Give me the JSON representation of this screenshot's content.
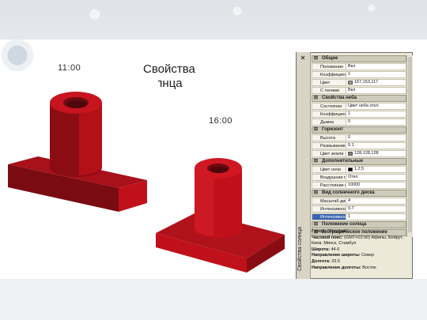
{
  "slide": {
    "time_left": "11:00",
    "time_right": "16:00",
    "title": "Свойства солнца"
  },
  "palette": {
    "solid_red": "#c0111a",
    "panel_bg": "#ece9d8",
    "selected": "#3a64b3"
  },
  "panel": {
    "side_label": "Свойства солнца",
    "sections": [
      {
        "title": "Общие",
        "rows": [
          {
            "key": "Положение",
            "value": "Вкл"
          },
          {
            "key": "Коэффициент ...",
            "value": "1"
          },
          {
            "key": "Цвет",
            "value": "167,153,117",
            "swatch": "#a79975"
          },
          {
            "key": "С тенями",
            "value": "Вкл"
          }
        ]
      },
      {
        "title": "Свойства неба",
        "rows": [
          {
            "key": "Состояние",
            "value": "Цвет неба откл"
          },
          {
            "key": "Коэффициент ...",
            "value": "1"
          },
          {
            "key": "Дымка",
            "value": "0"
          }
        ]
      },
      {
        "title": "Горизонт",
        "rows": [
          {
            "key": "Высота",
            "value": "0"
          },
          {
            "key": "Размывание",
            "value": "0.1"
          },
          {
            "key": "Цвет земли",
            "value": "128,128,128",
            "swatch": "#808080"
          }
        ]
      },
      {
        "title": "Дополнительные",
        "rows": [
          {
            "key": "Цвет ночи",
            "value": "1,2,5",
            "swatch": "#010205"
          },
          {
            "key": "Воздушная пе...",
            "value": "Откл"
          },
          {
            "key": "Расстояние ви...",
            "value": "10000"
          }
        ]
      },
      {
        "title": "Вид солнечного диска",
        "rows": [
          {
            "key": "Масштаб диска",
            "value": "4"
          },
          {
            "key": "Интенсивност...",
            "value": "0.7"
          },
          {
            "key": "Интенсивност...",
            "value": "1",
            "selected": true
          }
        ]
      },
      {
        "title": "Положение солнца",
        "rows": []
      },
      {
        "title": "Географическое положение",
        "rows": []
      }
    ],
    "geo": [
      {
        "label": "Город:",
        "value": "\"Текущий\""
      },
      {
        "label": "Часовой пояс:",
        "value": "(GMT+02:00) Афины, Бейрут, Киев, Минск, Стамбул"
      },
      {
        "label": "Широта:",
        "value": "44.6"
      },
      {
        "label": "Направление широты:",
        "value": "Север"
      },
      {
        "label": "Долгота:",
        "value": "33.5"
      },
      {
        "label": "Направление долготы:",
        "value": "Восток"
      }
    ]
  }
}
